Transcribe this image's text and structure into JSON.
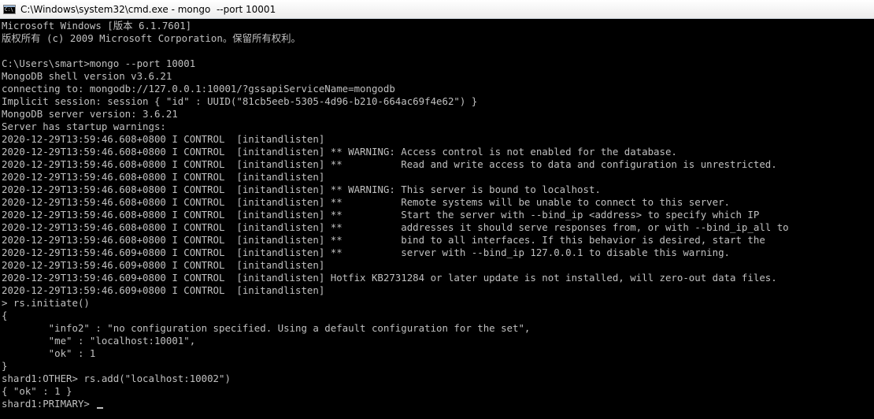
{
  "window": {
    "title": "C:\\Windows\\system32\\cmd.exe - mongo  --port 10001",
    "icon_name": "cmd-icon",
    "icon_text": "C:\\"
  },
  "console": {
    "lines": [
      "Microsoft Windows [版本 6.1.7601]",
      "版权所有 (c) 2009 Microsoft Corporation。保留所有权利。",
      "",
      "C:\\Users\\smart>mongo --port 10001",
      "MongoDB shell version v3.6.21",
      "connecting to: mongodb://127.0.0.1:10001/?gssapiServiceName=mongodb",
      "Implicit session: session { \"id\" : UUID(\"81cb5eeb-5305-4d96-b210-664ac69f4e62\") }",
      "MongoDB server version: 3.6.21",
      "Server has startup warnings:",
      "2020-12-29T13:59:46.608+0800 I CONTROL  [initandlisten]",
      "2020-12-29T13:59:46.608+0800 I CONTROL  [initandlisten] ** WARNING: Access control is not enabled for the database.",
      "2020-12-29T13:59:46.608+0800 I CONTROL  [initandlisten] **          Read and write access to data and configuration is unrestricted.",
      "2020-12-29T13:59:46.608+0800 I CONTROL  [initandlisten]",
      "2020-12-29T13:59:46.608+0800 I CONTROL  [initandlisten] ** WARNING: This server is bound to localhost.",
      "2020-12-29T13:59:46.608+0800 I CONTROL  [initandlisten] **          Remote systems will be unable to connect to this server.",
      "2020-12-29T13:59:46.608+0800 I CONTROL  [initandlisten] **          Start the server with --bind_ip <address> to specify which IP",
      "2020-12-29T13:59:46.608+0800 I CONTROL  [initandlisten] **          addresses it should serve responses from, or with --bind_ip_all to",
      "2020-12-29T13:59:46.608+0800 I CONTROL  [initandlisten] **          bind to all interfaces. If this behavior is desired, start the",
      "2020-12-29T13:59:46.609+0800 I CONTROL  [initandlisten] **          server with --bind_ip 127.0.0.1 to disable this warning.",
      "2020-12-29T13:59:46.609+0800 I CONTROL  [initandlisten]",
      "2020-12-29T13:59:46.609+0800 I CONTROL  [initandlisten] Hotfix KB2731284 or later update is not installed, will zero-out data files.",
      "2020-12-29T13:59:46.609+0800 I CONTROL  [initandlisten]",
      "> rs.initiate()",
      "{",
      "        \"info2\" : \"no configuration specified. Using a default configuration for the set\",",
      "        \"me\" : \"localhost:10001\",",
      "        \"ok\" : 1",
      "}",
      "shard1:OTHER> rs.add(\"localhost:10002\")",
      "{ \"ok\" : 1 }",
      "shard1:PRIMARY> "
    ]
  },
  "colors": {
    "background": "#000000",
    "foreground": "#c0c0c0"
  }
}
